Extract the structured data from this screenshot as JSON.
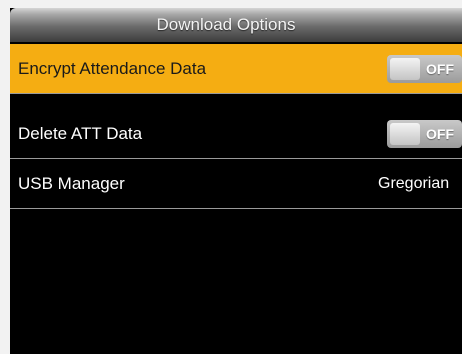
{
  "header": {
    "title": "Download Options"
  },
  "menu": {
    "items": [
      {
        "label": "Encrypt Attendance Data",
        "toggle": "OFF",
        "selected": true
      },
      {
        "label": "Delete ATT Data",
        "toggle": "OFF"
      },
      {
        "label": "USB Manager",
        "value": "Gregorian"
      }
    ]
  },
  "colors": {
    "selection": "#f5ad12",
    "background": "#000000",
    "text": "#ffffff"
  }
}
